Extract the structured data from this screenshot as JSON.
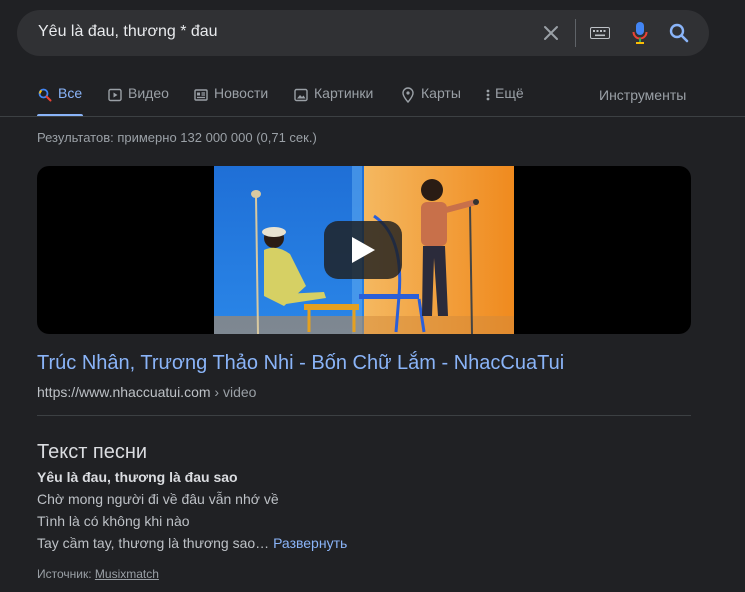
{
  "search": {
    "query": "Yêu là đau, thương * đau"
  },
  "tabs": [
    {
      "label": "Все",
      "icon": "search-icon",
      "active": true
    },
    {
      "label": "Видео",
      "icon": "video-icon"
    },
    {
      "label": "Новости",
      "icon": "news-icon"
    },
    {
      "label": "Картинки",
      "icon": "image-icon"
    },
    {
      "label": "Карты",
      "icon": "map-pin-icon"
    },
    {
      "label": "Ещё",
      "icon": "more-vert-icon"
    }
  ],
  "tools_label": "Инструменты",
  "stats": "Результатов: примерно 132 000 000 (0,71 сек.)",
  "result": {
    "title": "Trúc Nhân, Trương Thảo Nhi - Bốn Chữ Lắm - NhacCuaTui",
    "url": "https://www.nhaccuatui.com",
    "crumb": " › video"
  },
  "lyrics": {
    "heading": "Текст песни",
    "lines": [
      "Yêu là đau, thương là đau sao",
      "Chờ mong người đi về đâu vẫn nhớ về",
      "Tình là có không khi nào",
      "Tay cầm tay, thương là thương sao…"
    ],
    "expand_label": "Развернуть",
    "source_label": "Источник: ",
    "source_link": "Musixmatch"
  },
  "colors": {
    "background": "#202124",
    "link": "#8ab4f8",
    "surface": "#303134"
  }
}
